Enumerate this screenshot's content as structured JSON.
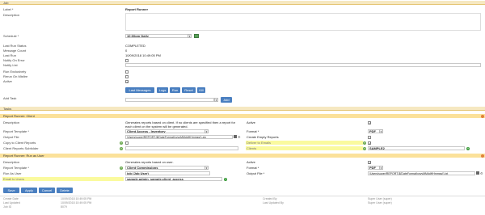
{
  "job": {
    "section_title": "Job",
    "label_label": "Label *",
    "label_value": "Report Runner",
    "description_label": "Description",
    "schedule_label": "Schedule *",
    "schedule_value": "10:00pm Daily",
    "last_run_status_label": "Last Run Status",
    "last_run_status_value": "COMPLETED",
    "message_count_label": "Message Count",
    "message_count_value": "0",
    "last_run_label": "Last Run",
    "last_run_value": "10/09/2018 10:49:05 PM",
    "notify_on_error_label": "Notify On Error",
    "notify_list_label": "Notify List",
    "run_exclusively_label": "Run Exclusively",
    "rerun_on_misfire_label": "Rerun On Misfire",
    "active_label": "Active",
    "buttons": {
      "last_messages": "Last Messages",
      "logs": "Logs",
      "run": "Run",
      "reset": "Reset",
      "kill": "Kill"
    },
    "add_task_label": "Add Task",
    "add_button": "Add"
  },
  "tasks": {
    "section_title": "Tasks",
    "client": {
      "title": "Report Runner: Client",
      "description_label": "Description",
      "description_value": "Generates reports based on client. If no clients are specified then a report for each client on the system will be generated.",
      "report_template_label": "Report Template *",
      "report_template_value": "Client Access - Inventory",
      "output_file_label": "Output File",
      "output_file_value": "/Users/super/REPORT-${DateFormat(yyyyMMddHHmmss)}.zip",
      "copy_to_client_label": "Copy to Client Reports",
      "client_subfolder_label": "Client Reports Subfolder",
      "active_label": "Active",
      "format_label": "Format *",
      "format_value": "PDF",
      "create_empty_label": "Create Empty Reports",
      "deliver_email_label": "Deliver to Emails",
      "clients_label": "Clients",
      "clients_value": "SAMPLE2",
      "help_icon": "?"
    },
    "user": {
      "title": "Report Runner: Run as User",
      "description_label": "Description",
      "description_value": "Generates reports based on user.",
      "report_template_label": "Report Template *",
      "report_template_value": "Client Commissions",
      "run_as_user_label": "Run As User",
      "run_as_user_value": "job (Job User)",
      "email_users_label": "Email to Users",
      "email_users_value": "sample.admin, sample.client_access",
      "active_label": "Active",
      "format_label": "Format *",
      "format_value": "PDF",
      "output_file_label": "Output File *",
      "output_file_value": "/Users/super/REPORT-${DateFormat(yyyyMMddHHmmss)}.txt"
    }
  },
  "actions": {
    "save": "Save",
    "apply": "Apply",
    "cancel": "Cancel",
    "delete": "Delete"
  },
  "footer": {
    "create_date_label": "Create Date",
    "create_date_value": "10/09/2018 10:49:05 PM",
    "created_by_label": "Created By",
    "created_by_value": "Super User (super)",
    "last_updated_label": "Last Updated",
    "last_updated_value": "10/09/2018 10:49:05 PM",
    "last_updated_by_label": "Last Updated By",
    "last_updated_by_value": "Super User (super)",
    "job_id_label": "Job ID",
    "job_id_value": "8079"
  }
}
